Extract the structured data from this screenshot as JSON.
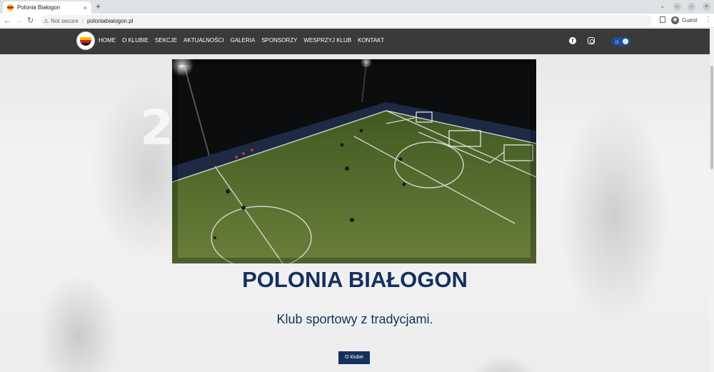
{
  "browser": {
    "tab_title": "Polonia Białogon",
    "tab_close": "×",
    "new_tab": "+",
    "tab_search": "⌄",
    "security_label": "Not secure",
    "url": "poloniabialogon.pl",
    "profile_label": "Guest",
    "window_controls": {
      "minimize": "–",
      "restore": "▫",
      "close": "×"
    },
    "nav": {
      "back": "←",
      "forward": "→",
      "reload": "↻"
    },
    "menu_glyph": "⋮"
  },
  "site": {
    "menu": [
      "HOME",
      "O KLUBIE",
      "SEKCJE",
      "AKTUALNOŚCI",
      "GALERIA",
      "SPONSORZY",
      "WESPRZYJ KLUB",
      "KONTAKT"
    ],
    "social": {
      "facebook_glyph": "f"
    },
    "theme_toggle_glyph": "☼",
    "background_number": "2",
    "hero": {
      "title": "POLONIA BIAŁOGON",
      "subtitle": "Klub sportowy z tradycjami.",
      "button": "O klubie"
    },
    "colors": {
      "navbar": "#3a3a3a",
      "brand_blue": "#14305e",
      "toggle_blue": "#1b4fa0",
      "pitch_green": "#4d6b2a"
    },
    "icons": [
      "facebook-icon",
      "instagram-icon",
      "theme-toggle",
      "warning-icon",
      "profile-icon"
    ]
  }
}
